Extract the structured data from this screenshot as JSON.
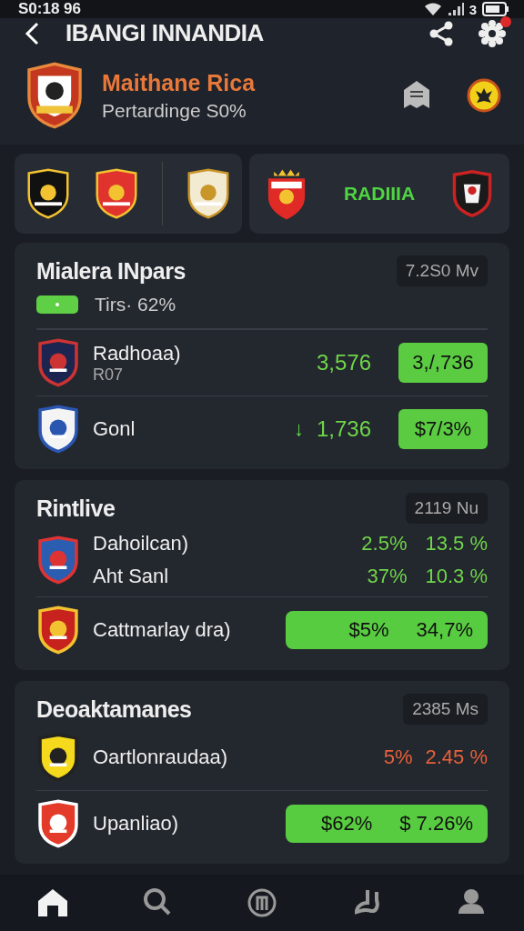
{
  "status_bar": {
    "time": "S0:18 96",
    "battery_text": "3"
  },
  "header": {
    "title": "IBANGI INNANDIA",
    "has_notification": true
  },
  "team": {
    "name": "Maithane Rica",
    "subtitle": "Pertardinge S0%"
  },
  "crest_strip": {
    "label": "RADIIIA"
  },
  "sections": [
    {
      "title": "Mialera INpars",
      "badge": "7.2S0 Mv",
      "subtitle": "Tirs· 62%",
      "rows": [
        {
          "kind": "pill",
          "name": "Radhoaa)",
          "sub": "R07",
          "value": "3,576",
          "pill": "3,/,736"
        },
        {
          "kind": "pill",
          "name": "Gonl",
          "arrow": "↓",
          "value": "1,736",
          "pill": "$7/3%"
        }
      ]
    },
    {
      "title": "Rintlive",
      "badge": "2119 Nu",
      "rows": [
        {
          "kind": "double",
          "lines": [
            {
              "name": "Dahoilcan)",
              "a": "2.5%",
              "b": "13.5 %",
              "color": "#6fd64a"
            },
            {
              "name": "Aht Sanl",
              "a": "37%",
              "b": "10.3 %",
              "color": "#6fd64a"
            }
          ]
        },
        {
          "kind": "bar",
          "name": "Cattmarlay dra)",
          "a": "$5%",
          "b": "34,7%"
        }
      ]
    },
    {
      "title": "Deoaktamanes",
      "badge": "2385 Ms",
      "rows": [
        {
          "kind": "plain",
          "name": "Oartlonraudaa)",
          "a": "5%",
          "b": "2.45 %",
          "color": "#e8613a"
        },
        {
          "kind": "bar",
          "name": "Upanliao)",
          "a": "$62%",
          "b": "$ 7.26%"
        }
      ]
    }
  ],
  "nav": [
    {
      "kind": "home",
      "selected": true
    },
    {
      "kind": "search",
      "selected": false
    },
    {
      "kind": "coin",
      "selected": false
    },
    {
      "kind": "whistle",
      "selected": false
    },
    {
      "kind": "profile",
      "selected": false
    }
  ]
}
